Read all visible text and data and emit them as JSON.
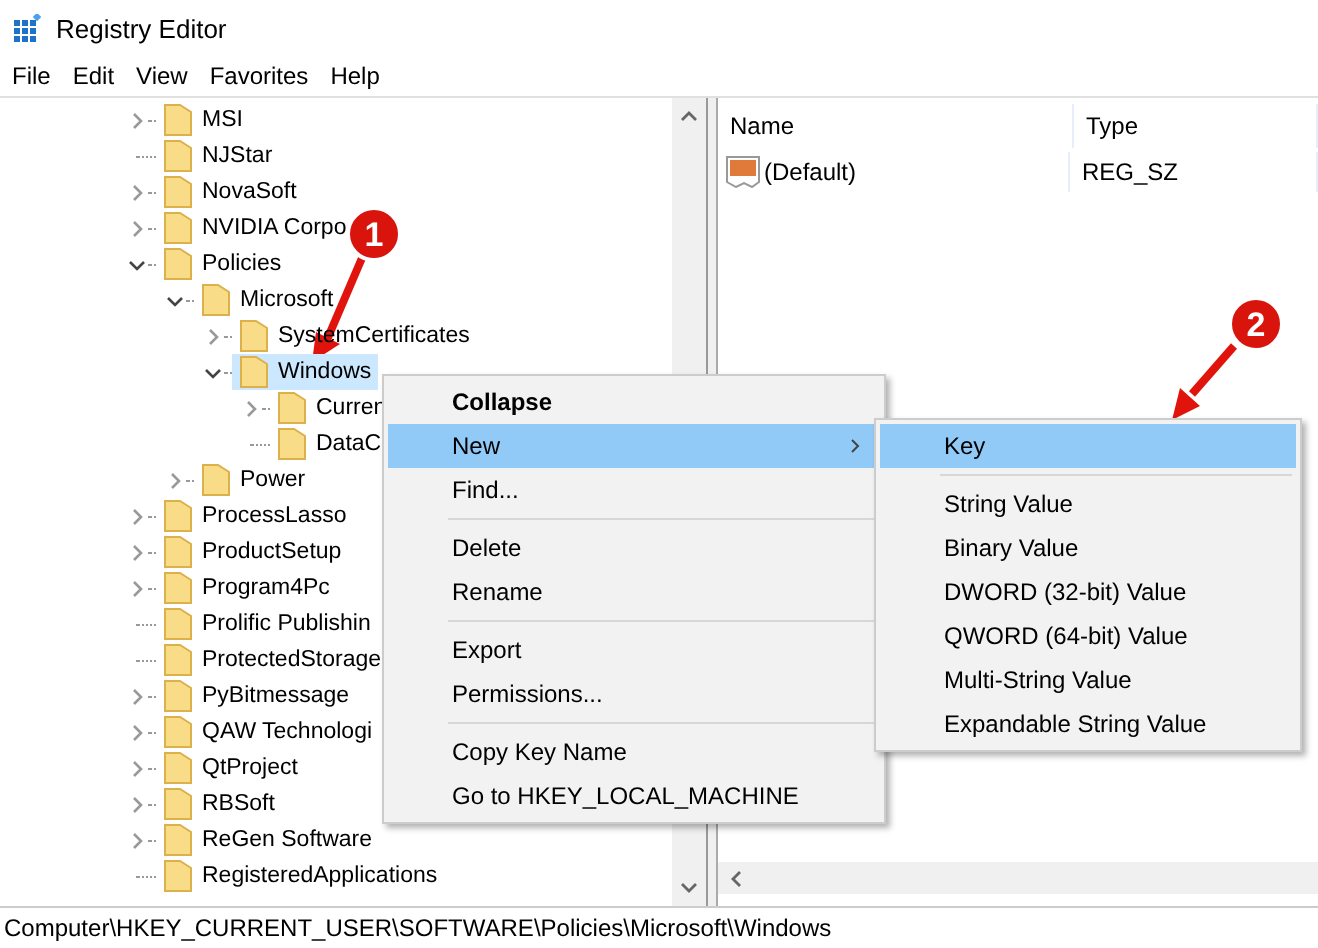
{
  "window": {
    "title": "Registry Editor"
  },
  "menu_bar": [
    "File",
    "Edit",
    "View",
    "Favorites",
    "Help"
  ],
  "tree": {
    "items": [
      {
        "label": "MSI",
        "kind": "collapsed",
        "selected": false
      },
      {
        "label": "NJStar",
        "kind": "leaf",
        "selected": false
      },
      {
        "label": "NovaSoft",
        "kind": "collapsed",
        "selected": false
      },
      {
        "label": "NVIDIA Corpo",
        "kind": "collapsed",
        "selected": false
      },
      {
        "label": "Policies",
        "kind": "expanded",
        "selected": false,
        "children": [
          {
            "label": "Microsoft",
            "kind": "expanded",
            "selected": false,
            "children": [
              {
                "label": "SystemCertificates",
                "kind": "collapsed",
                "selected": false
              },
              {
                "label": "Windows",
                "kind": "expanded",
                "selected": true,
                "children": [
                  {
                    "label": "Curren",
                    "kind": "collapsed",
                    "selected": false
                  },
                  {
                    "label": "DataC",
                    "kind": "leaf",
                    "selected": false
                  }
                ]
              }
            ]
          },
          {
            "label": "Power",
            "kind": "collapsed",
            "selected": false
          }
        ]
      },
      {
        "label": "ProcessLasso",
        "kind": "collapsed",
        "selected": false
      },
      {
        "label": "ProductSetup",
        "kind": "collapsed",
        "selected": false
      },
      {
        "label": "Program4Pc",
        "kind": "collapsed",
        "selected": false
      },
      {
        "label": "Prolific Publishin",
        "kind": "leaf",
        "selected": false
      },
      {
        "label": "ProtectedStorage",
        "kind": "leaf",
        "selected": false
      },
      {
        "label": "PyBitmessage",
        "kind": "collapsed",
        "selected": false
      },
      {
        "label": "QAW Technologi",
        "kind": "collapsed",
        "selected": false
      },
      {
        "label": "QtProject",
        "kind": "collapsed",
        "selected": false
      },
      {
        "label": "RBSoft",
        "kind": "collapsed",
        "selected": false
      },
      {
        "label": "ReGen Software",
        "kind": "collapsed",
        "selected": false
      },
      {
        "label": "RegisteredApplications",
        "kind": "leaf",
        "selected": false
      }
    ]
  },
  "values": {
    "columns": [
      "Name",
      "Type"
    ],
    "rows": [
      {
        "name": "(Default)",
        "type": "REG_SZ"
      }
    ]
  },
  "context_menu": {
    "groups": [
      [
        {
          "label": "Collapse",
          "default": true,
          "selected": false,
          "submenu": false
        },
        {
          "label": "New",
          "default": false,
          "selected": true,
          "submenu": true
        },
        {
          "label": "Find...",
          "default": false,
          "selected": false,
          "submenu": false
        }
      ],
      [
        {
          "label": "Delete",
          "default": false,
          "selected": false,
          "submenu": false
        },
        {
          "label": "Rename",
          "default": false,
          "selected": false,
          "submenu": false
        }
      ],
      [
        {
          "label": "Export",
          "default": false,
          "selected": false,
          "submenu": false
        },
        {
          "label": "Permissions...",
          "default": false,
          "selected": false,
          "submenu": false
        }
      ],
      [
        {
          "label": "Copy Key Name",
          "default": false,
          "selected": false,
          "submenu": false
        },
        {
          "label": "Go to HKEY_LOCAL_MACHINE",
          "default": false,
          "selected": false,
          "submenu": false
        }
      ]
    ]
  },
  "submenu": {
    "groups": [
      [
        {
          "label": "Key",
          "selected": true
        }
      ],
      [
        {
          "label": "String Value",
          "selected": false
        },
        {
          "label": "Binary Value",
          "selected": false
        },
        {
          "label": "DWORD (32-bit) Value",
          "selected": false
        },
        {
          "label": "QWORD (64-bit) Value",
          "selected": false
        },
        {
          "label": "Multi-String Value",
          "selected": false
        },
        {
          "label": "Expandable String Value",
          "selected": false
        }
      ]
    ]
  },
  "annotations": [
    "1",
    "2"
  ],
  "status_bar": "Computer\\HKEY_CURRENT_USER\\SOFTWARE\\Policies\\Microsoft\\Windows"
}
